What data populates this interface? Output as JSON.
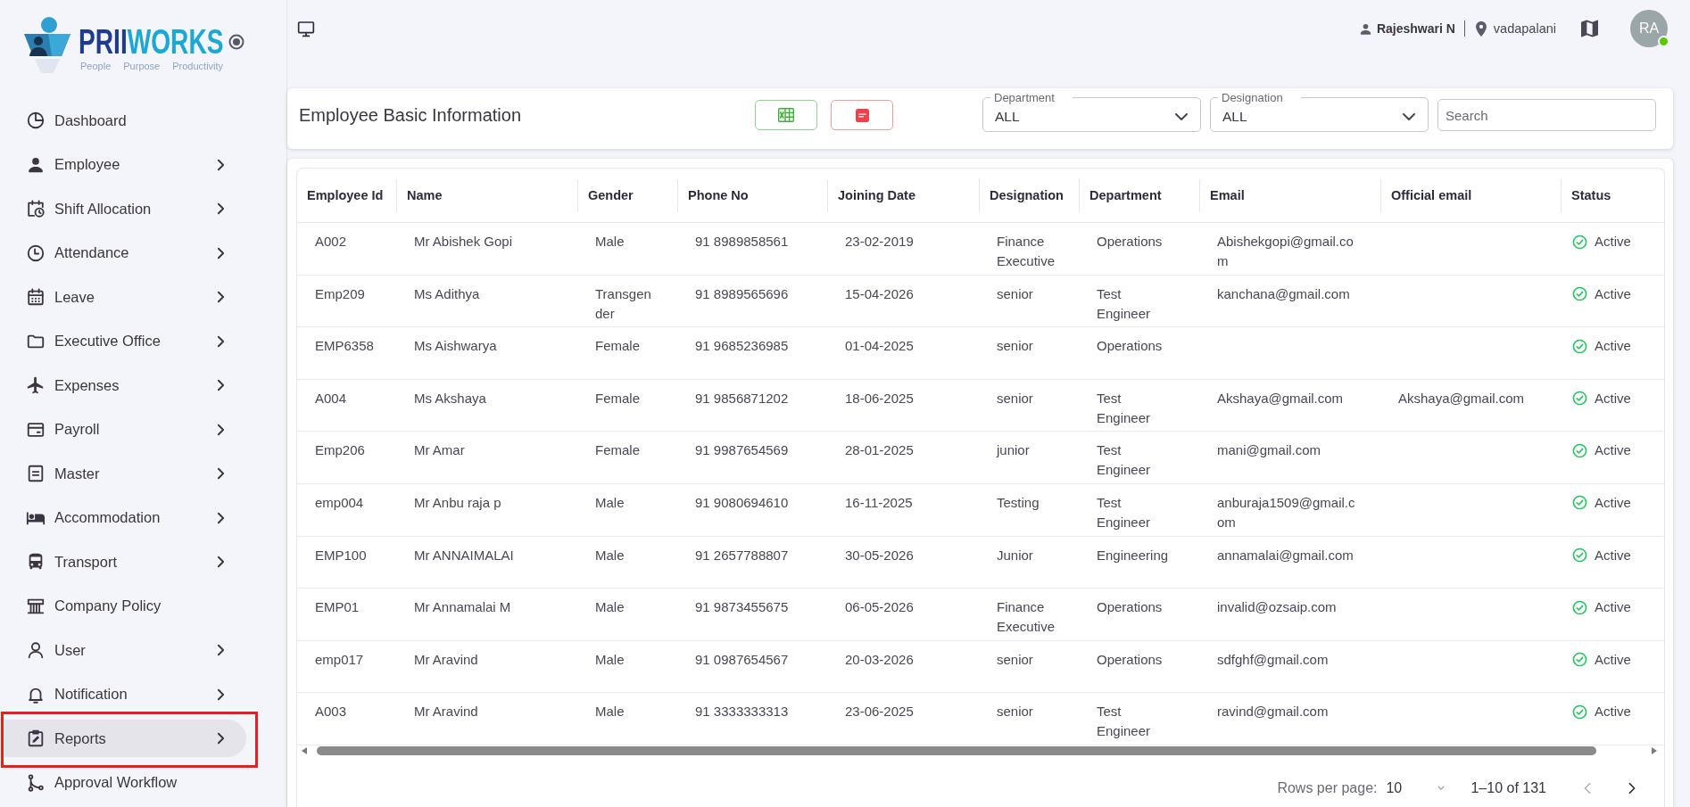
{
  "logo": {
    "wordmark": [
      "PRII",
      "WORKS"
    ],
    "tagline": [
      "People",
      "Purpose",
      "Productivity"
    ]
  },
  "sidebar": {
    "items": [
      {
        "label": "Dashboard",
        "expandable": false,
        "selected": false,
        "annotated": false
      },
      {
        "label": "Employee",
        "expandable": true,
        "selected": false,
        "annotated": false
      },
      {
        "label": "Shift Allocation",
        "expandable": true,
        "selected": false,
        "annotated": false
      },
      {
        "label": "Attendance",
        "expandable": true,
        "selected": false,
        "annotated": false
      },
      {
        "label": "Leave",
        "expandable": true,
        "selected": false,
        "annotated": false
      },
      {
        "label": "Executive Office",
        "expandable": true,
        "selected": false,
        "annotated": false
      },
      {
        "label": "Expenses",
        "expandable": true,
        "selected": false,
        "annotated": false
      },
      {
        "label": "Payroll",
        "expandable": true,
        "selected": false,
        "annotated": false
      },
      {
        "label": "Master",
        "expandable": true,
        "selected": false,
        "annotated": false
      },
      {
        "label": "Accommodation",
        "expandable": true,
        "selected": false,
        "annotated": false
      },
      {
        "label": "Transport",
        "expandable": true,
        "selected": false,
        "annotated": false
      },
      {
        "label": "Company Policy",
        "expandable": false,
        "selected": false,
        "annotated": false
      },
      {
        "label": "User",
        "expandable": true,
        "selected": false,
        "annotated": false
      },
      {
        "label": "Notification",
        "expandable": true,
        "selected": false,
        "annotated": false
      },
      {
        "label": "Reports",
        "expandable": true,
        "selected": true,
        "annotated": true
      },
      {
        "label": "Approval Workflow",
        "expandable": false,
        "selected": false,
        "annotated": false
      }
    ]
  },
  "top_bar": {
    "user_name": "Rajeshwari N",
    "location": "vadapalani",
    "avatar": {
      "initials": "RA",
      "online": true
    }
  },
  "toolbar": {
    "title": "Employee Basic Information",
    "exports": [
      {
        "kind": "excel"
      },
      {
        "kind": "pdf"
      }
    ],
    "filters": [
      {
        "label": "Department",
        "value": "ALL"
      },
      {
        "label": "Designation",
        "value": "ALL"
      }
    ],
    "search": {
      "placeholder": "Search"
    }
  },
  "table": {
    "columns": [
      {
        "label": "Employee Id",
        "kind": "text"
      },
      {
        "label": "Name",
        "kind": "text"
      },
      {
        "label": "Gender",
        "kind": "text"
      },
      {
        "label": "Phone No",
        "kind": "text"
      },
      {
        "label": "Joining Date",
        "kind": "text"
      },
      {
        "label": "Designation",
        "kind": "text"
      },
      {
        "label": "Department",
        "kind": "text"
      },
      {
        "label": "Email",
        "kind": "text"
      },
      {
        "label": "Official email",
        "kind": "text"
      },
      {
        "label": "Status",
        "kind": "status"
      }
    ],
    "rows": [
      [
        "A002",
        "Mr Abishek Gopi",
        "Male",
        "91 8989858561",
        "23-02-2019",
        "Finance Executive",
        "Operations",
        "Abishekgopi@gmail.com",
        null,
        "Active"
      ],
      [
        "Emp209",
        "Ms Adithya",
        "Transgender",
        "91 8989565696",
        "15-04-2026",
        "senior",
        "Test Engineer",
        "kanchana@gmail.com",
        null,
        "Active"
      ],
      [
        "EMP6358",
        "Ms Aishwarya",
        "Female",
        "91 9685236985",
        "01-04-2025",
        "senior",
        "Operations",
        null,
        null,
        "Active"
      ],
      [
        "A004",
        "Ms Akshaya",
        "Female",
        "91 9856871202",
        "18-06-2025",
        "senior",
        "Test Engineer",
        "Akshaya@gmail.com",
        "Akshaya@gmail.com",
        "Active"
      ],
      [
        "Emp206",
        "Mr Amar",
        "Female",
        "91 9987654569",
        "28-01-2025",
        "junior",
        "Test Engineer",
        "mani@gmail.com",
        null,
        "Active"
      ],
      [
        "emp004",
        "Mr Anbu raja p",
        "Male",
        "91 9080694610",
        "16-11-2025",
        "Testing",
        "Test Engineer",
        "anburaja1509@gmail.com",
        null,
        "Active"
      ],
      [
        "EMP100",
        "Mr ANNAIMALAI",
        "Male",
        "91 2657788807",
        "30-05-2026",
        "Junior",
        "Engineering",
        "annamalai@gmail.com",
        null,
        "Active"
      ],
      [
        "EMP01",
        "Mr Annamalai M",
        "Male",
        "91 9873455675",
        "06-05-2026",
        "Finance Executive",
        "Operations",
        "invalid@ozsaip.com",
        null,
        "Active"
      ],
      [
        "emp017",
        "Mr Aravind",
        "Male",
        "91 0987654567",
        "20-03-2026",
        "senior",
        "Operations",
        "sdfghf@gmail.com",
        null,
        "Active"
      ],
      [
        "A003",
        "Mr Aravind",
        "Male",
        "91 3333333313",
        "23-06-2025",
        "senior",
        "Test Engineer",
        "ravind@gmail.com",
        null,
        "Active"
      ]
    ]
  },
  "pagination": {
    "rows_per_page_label": "Rows per page:",
    "rows_per_page": "10",
    "range": "1–10 of 131",
    "previous_disabled": true,
    "next_disabled": false
  }
}
